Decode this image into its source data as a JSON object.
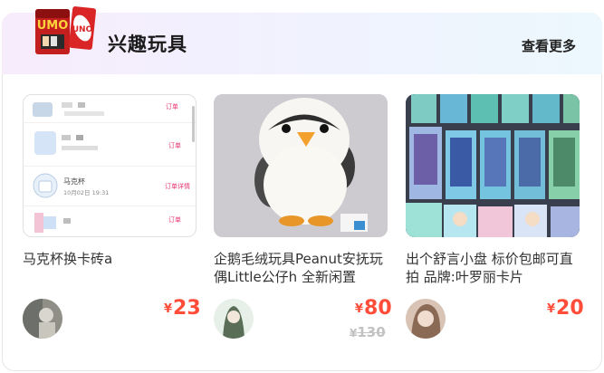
{
  "section": {
    "title": "兴趣玩具",
    "more_label": "查看更多",
    "logo_text_1": "UMO",
    "logo_text_2": "UNO"
  },
  "products": [
    {
      "title": "马克杯换卡砖a",
      "price_symbol": "¥",
      "price": "23",
      "thumb_rows": [
        {
          "name": "",
          "date": "",
          "action": "订单"
        },
        {
          "name": "",
          "date": "",
          "action": "订单"
        },
        {
          "name": "马克杯",
          "date": "10月02日 19:31",
          "action": "订单详情"
        },
        {
          "name": "",
          "date": "",
          "action": "订单"
        }
      ]
    },
    {
      "title": "企鹅毛绒玩具Peanut安抚玩偶Little公仔h 全新闲置",
      "price_symbol": "¥",
      "price": "80",
      "original_price_symbol": "¥",
      "original_price": "130"
    },
    {
      "title": "出个舒言小盘 标价包邮可直拍 品牌:叶罗丽卡片",
      "price_symbol": "¥",
      "price": "20"
    }
  ],
  "colors": {
    "price": "#ff4d39",
    "old_price": "#c2c2c2",
    "accent_pink": "#e8336d"
  }
}
